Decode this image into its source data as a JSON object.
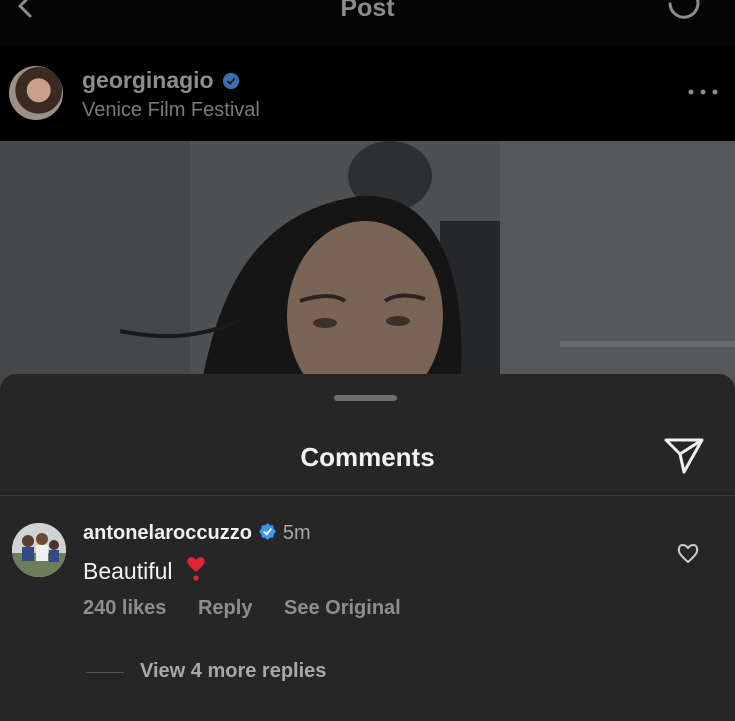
{
  "nav": {
    "title": "Post",
    "back_icon": "chevron-left-icon",
    "refresh_icon": "refresh-icon"
  },
  "post": {
    "username": "georginagio",
    "location": "Venice Film Festival",
    "more_icon": "more-horizontal-icon"
  },
  "comments_sheet": {
    "title": "Comments",
    "share_icon": "paper-plane-icon",
    "comment": {
      "username": "antonelaroccuzzo",
      "time": "5m",
      "text": "Beautiful",
      "emoji": "❣️",
      "likes": "240 likes",
      "reply_label": "Reply",
      "see_original_label": "See Original"
    },
    "view_replies_label": "View 4 more replies"
  },
  "colors": {
    "background": "#000000",
    "sheet": "#262626",
    "verified_blue": "#3897f0",
    "heart_red": "#e0243a"
  }
}
